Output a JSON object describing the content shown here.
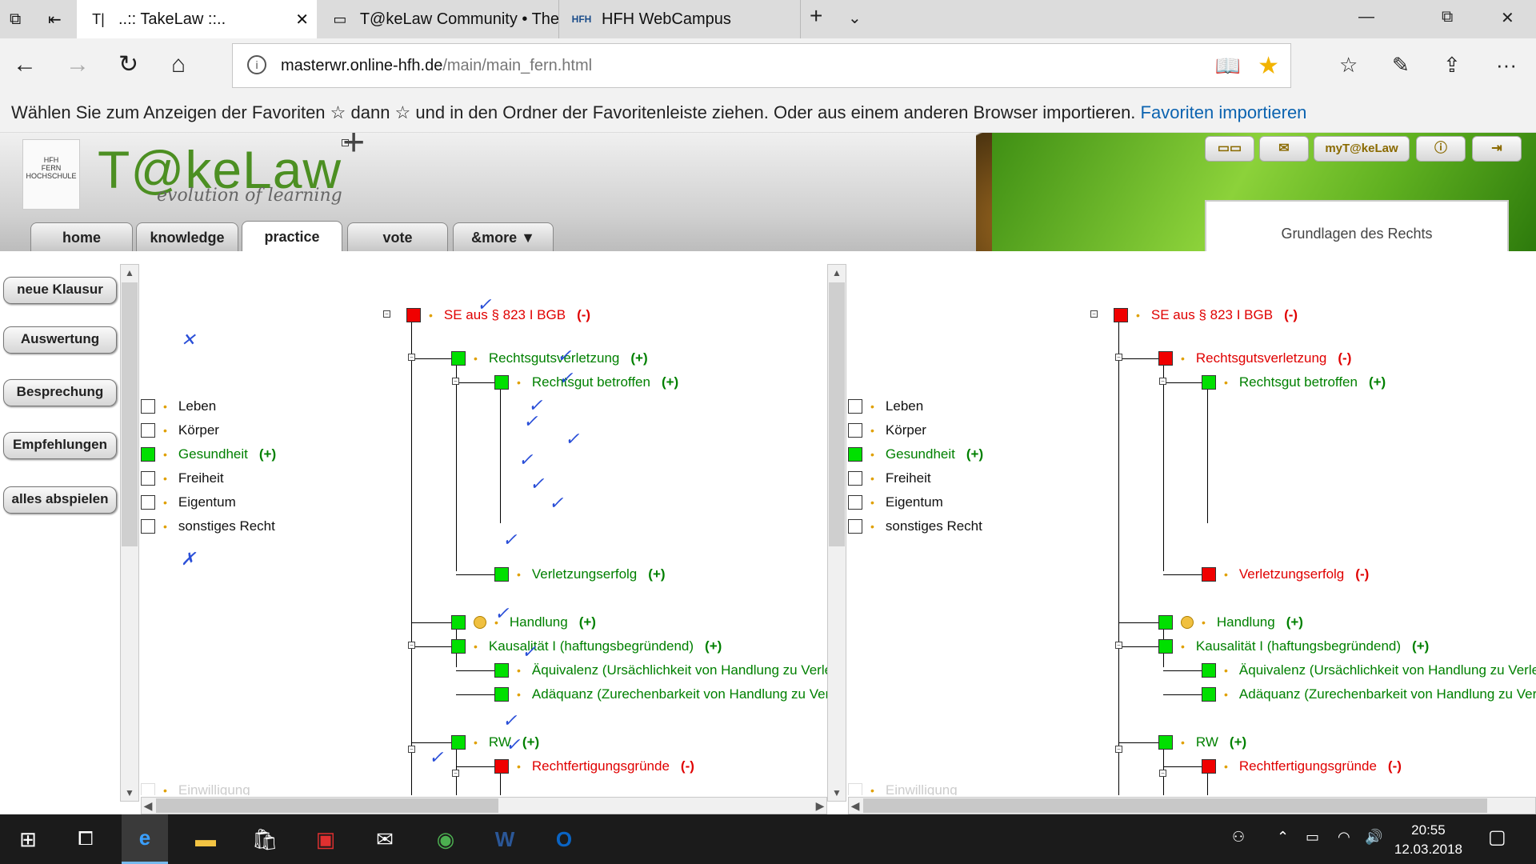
{
  "browser": {
    "tabs": [
      {
        "icon": "T|",
        "title": "..:: TakeLaw ::..",
        "active": true
      },
      {
        "icon": "▭",
        "title": "T@keLaw Community • The",
        "active": false
      },
      {
        "icon": "HFH",
        "title": "HFH WebCampus",
        "active": false
      }
    ],
    "url_host": "masterwr.online-hfh.de",
    "url_path": "/main/main_fern.html",
    "fav_prompt": "Wählen Sie zum Anzeigen der Favoriten  ☆  dann ☆ und in den Ordner der Favoritenleiste ziehen. Oder aus einem anderen Browser importieren.",
    "fav_link": "Favoriten importieren"
  },
  "site": {
    "logo_main": "T@keLaw",
    "logo_plus": "+",
    "slogan": "evolution of learning",
    "nav_tabs": [
      "home",
      "knowledge",
      "practice",
      "vote",
      "&more ▼"
    ],
    "active_tab": "practice",
    "mytakelaw": "myT@keLaw",
    "course_title": "Grundlagen des Rechts"
  },
  "sidebar": [
    "neue Klausur",
    "Auswertung",
    "Besprechung",
    "Empfehlungen",
    "alles abspielen"
  ],
  "left_tree": [
    {
      "label": "SE aus § 823 I BGB",
      "mark": "(-)",
      "color": "r"
    },
    {
      "label": "Rechtsgutsverletzung",
      "mark": "(+)",
      "color": "g"
    },
    {
      "label": "Rechtsgut betroffen",
      "mark": "(+)",
      "color": "g"
    },
    {
      "label": "Leben",
      "mark": "",
      "color": "k"
    },
    {
      "label": "Körper",
      "mark": "",
      "color": "k"
    },
    {
      "label": "Gesundheit",
      "mark": "(+)",
      "color": "g"
    },
    {
      "label": "Freiheit",
      "mark": "",
      "color": "k"
    },
    {
      "label": "Eigentum",
      "mark": "",
      "color": "k"
    },
    {
      "label": "sonstiges Recht",
      "mark": "",
      "color": "k"
    },
    {
      "label": "Verletzungserfolg",
      "mark": "(+)",
      "color": "g"
    },
    {
      "label": "Handlung",
      "mark": "(+)",
      "color": "g"
    },
    {
      "label": "Kausalität I (haftungsbegründend)",
      "mark": "(+)",
      "color": "g"
    },
    {
      "label": "Äquivalenz (Ursächlichkeit von Handlung zu Verletzungserfolg)",
      "mark": "(+)",
      "color": "g"
    },
    {
      "label": "Adäquanz (Zurechenbarkeit von Handlung zu Verletzungserfolg)",
      "mark": "(+",
      "color": "g"
    },
    {
      "label": "RW",
      "mark": "(+)",
      "color": "g"
    },
    {
      "label": "Rechtfertigungsgründe",
      "mark": "(-)",
      "color": "r"
    },
    {
      "label": "Einwilligung",
      "mark": "",
      "color": "f"
    }
  ],
  "right_tree": [
    {
      "label": "SE aus § 823 I BGB",
      "mark": "(-)",
      "color": "r"
    },
    {
      "label": "Rechtsgutsverletzung",
      "mark": "(-)",
      "color": "r"
    },
    {
      "label": "Rechtsgut betroffen",
      "mark": "(+)",
      "color": "g"
    },
    {
      "label": "Leben",
      "mark": "",
      "color": "k"
    },
    {
      "label": "Körper",
      "mark": "",
      "color": "k"
    },
    {
      "label": "Gesundheit",
      "mark": "(+)",
      "color": "g"
    },
    {
      "label": "Freiheit",
      "mark": "",
      "color": "k"
    },
    {
      "label": "Eigentum",
      "mark": "",
      "color": "k"
    },
    {
      "label": "sonstiges Recht",
      "mark": "",
      "color": "k"
    },
    {
      "label": "Verletzungserfolg",
      "mark": "(-)",
      "color": "r"
    },
    {
      "label": "Handlung",
      "mark": "(+)",
      "color": "g"
    },
    {
      "label": "Kausalität I (haftungsbegründend)",
      "mark": "(+)",
      "color": "g"
    },
    {
      "label": "Äquivalenz (Ursächlichkeit von Handlung zu Verletzungserfolg)",
      "mark": "(+)",
      "color": "g"
    },
    {
      "label": "Adäquanz (Zurechenbarkeit von Handlung zu Verletzungserfolg)",
      "mark": "(+)",
      "color": "g"
    },
    {
      "label": "RW",
      "mark": "(+)",
      "color": "g"
    },
    {
      "label": "Rechtfertigungsgründe",
      "mark": "(-)",
      "color": "r"
    },
    {
      "label": "Einwilligung",
      "mark": "",
      "color": "f"
    }
  ],
  "taskbar": {
    "time": "20:55",
    "date": "12.03.2018"
  }
}
